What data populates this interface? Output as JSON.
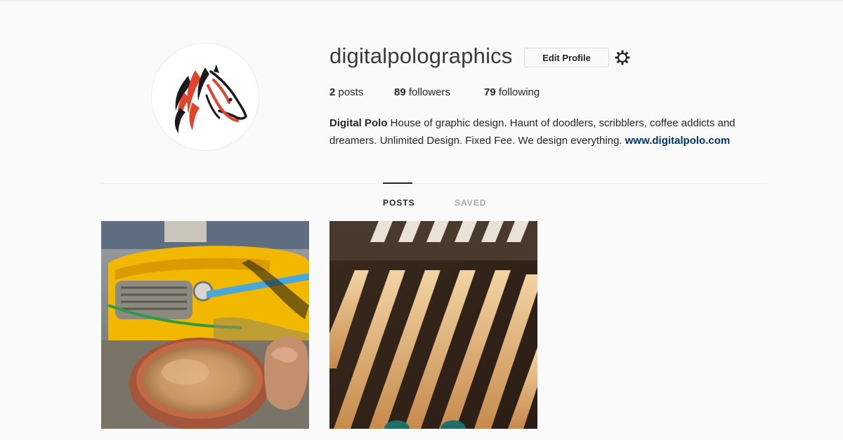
{
  "profile": {
    "username": "digitalpolographics",
    "edit_label": "Edit Profile",
    "stats": {
      "posts_count": "2",
      "posts_label": "posts",
      "followers_count": "89",
      "followers_label": "followers",
      "following_count": "79",
      "following_label": "following"
    },
    "bio": {
      "name": "Digital Polo",
      "text": "House of graphic design. Haunt of doodlers, scribblers, coffee addicts and dreamers. Unlimited Design. Fixed Fee. We design everything.",
      "link": "www.digitalpolo.com"
    }
  },
  "tabs": [
    {
      "label": "POSTS",
      "active": true
    },
    {
      "label": "SAVED",
      "active": false
    }
  ],
  "colors": {
    "background": "#fafafa",
    "link": "#003569",
    "logo_red": "#e0442c",
    "logo_black": "#1a1a1a",
    "taxi_yellow": "#f2b800"
  },
  "icons": {
    "settings": "gear-icon",
    "avatar": "zebra-horse-logo"
  },
  "posts": [
    {
      "description": "yellow taxi with cup of tea"
    },
    {
      "description": "striped light shadows"
    }
  ]
}
